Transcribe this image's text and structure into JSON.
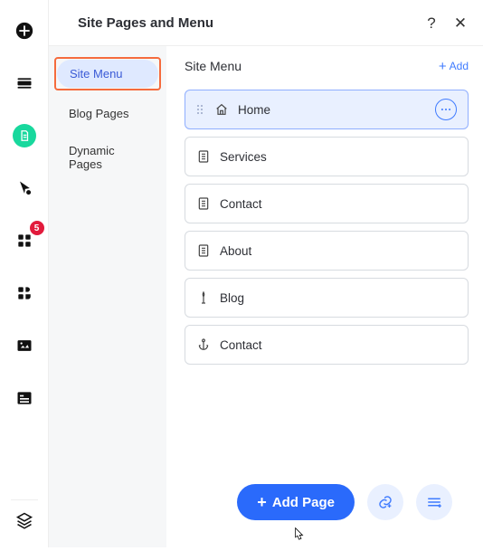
{
  "header": {
    "title": "Site Pages and Menu",
    "help": "?",
    "close": "✕"
  },
  "rail": {
    "badge": "5"
  },
  "sidebar": {
    "items": [
      {
        "label": "Site Menu"
      },
      {
        "label": "Blog Pages"
      },
      {
        "label": "Dynamic Pages"
      }
    ]
  },
  "content": {
    "title": "Site Menu",
    "add_label": "Add",
    "pages": [
      {
        "name": "Home"
      },
      {
        "name": "Services"
      },
      {
        "name": "Contact"
      },
      {
        "name": "About"
      },
      {
        "name": "Blog"
      },
      {
        "name": "Contact"
      }
    ]
  },
  "footer": {
    "add_page": "Add Page"
  },
  "colors": {
    "accent": "#2a6afb",
    "highlight": "#f56b3d",
    "green": "#18d89d"
  }
}
